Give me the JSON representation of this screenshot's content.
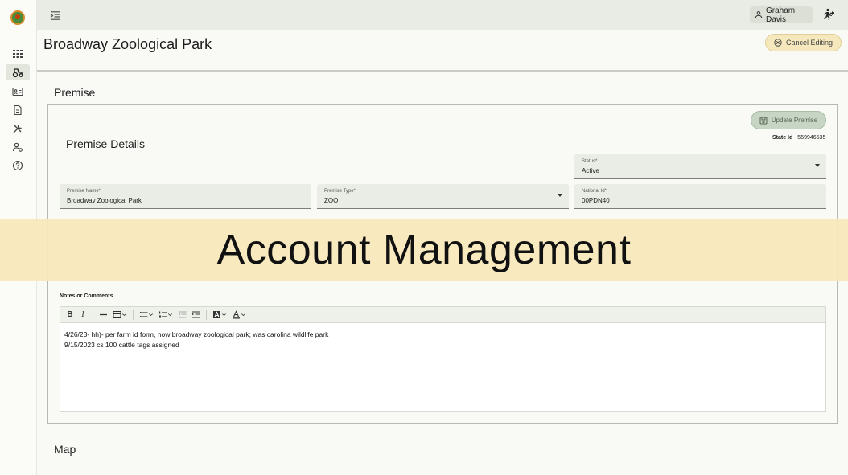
{
  "topbar": {
    "user_name": "Graham Davis"
  },
  "header": {
    "title": "Broadway Zoological Park",
    "cancel_label": "Cancel Editing"
  },
  "sections": {
    "premise": "Premise",
    "map": "Map"
  },
  "card": {
    "title": "Premise Details",
    "update_label": "Update Premise",
    "state_id_label": "State Id",
    "state_id_value": "559946535"
  },
  "fields": {
    "status": {
      "label": "Status*",
      "value": "Active"
    },
    "premise_name": {
      "label": "Premise Name*",
      "value": "Broadway Zoological Park"
    },
    "premise_type": {
      "label": "Premise Type*",
      "value": "ZOO"
    },
    "national_id": {
      "label": "National Id*",
      "value": "00PDN40"
    }
  },
  "notes": {
    "label": "Notes or Comments",
    "lines": [
      "4/26/23- hh)- per farm id form, now broadway zoological park; was carolina wildlife park",
      "9/15/2023 cs 100 cattle tags assigned"
    ],
    "toolbar": {
      "bold": "B",
      "italic": "I"
    }
  },
  "overlay": {
    "text": "Account Management"
  },
  "icons": {
    "rail": [
      "dashboard-icon",
      "tractor-icon",
      "id-card-icon",
      "document-icon",
      "tools-icon",
      "user-settings-icon",
      "help-icon"
    ]
  }
}
